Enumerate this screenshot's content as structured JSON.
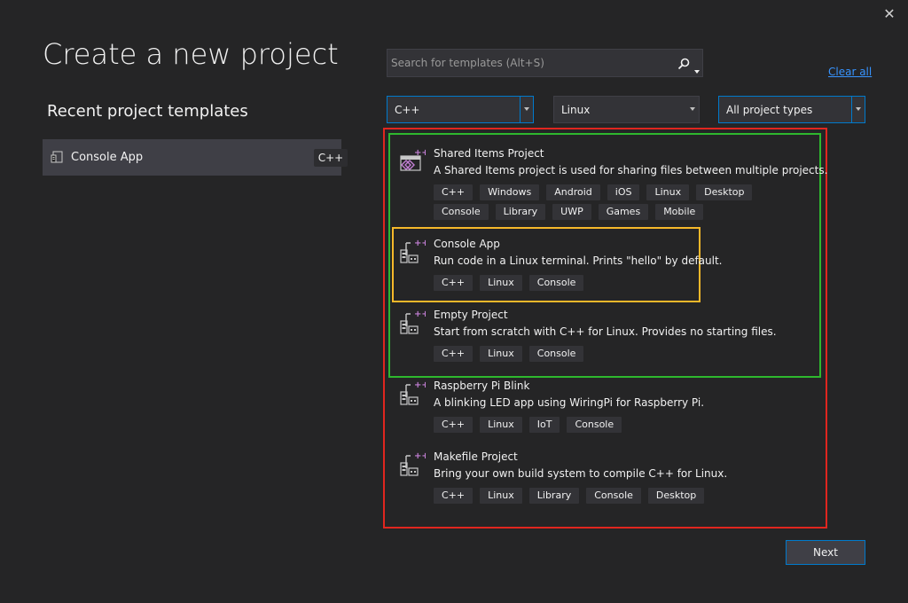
{
  "title": "Create a new project",
  "recent": {
    "heading": "Recent project templates",
    "items": [
      {
        "name": "Console App",
        "lang": "C++"
      }
    ]
  },
  "search": {
    "placeholder": "Search for templates (Alt+S)"
  },
  "clear_all": "Clear all",
  "filters": {
    "language": "C++",
    "platform": "Linux",
    "project_type": "All project types"
  },
  "templates": [
    {
      "name": "Shared Items Project",
      "desc": "A Shared Items project is used for sharing files between multiple projects.",
      "icon": "shared-items-icon",
      "tags": [
        "C++",
        "Windows",
        "Android",
        "iOS",
        "Linux",
        "Desktop",
        "Console",
        "Library",
        "UWP",
        "Games",
        "Mobile"
      ]
    },
    {
      "name": "Console App",
      "desc": "Run code in a Linux terminal. Prints \"hello\" by default.",
      "icon": "linux-project-icon",
      "tags": [
        "C++",
        "Linux",
        "Console"
      ]
    },
    {
      "name": "Empty Project",
      "desc": "Start from scratch with C++ for Linux. Provides no starting files.",
      "icon": "linux-project-icon",
      "tags": [
        "C++",
        "Linux",
        "Console"
      ]
    },
    {
      "name": "Raspberry Pi Blink",
      "desc": "A blinking LED app using WiringPi for Raspberry Pi.",
      "icon": "linux-project-icon",
      "tags": [
        "C++",
        "Linux",
        "IoT",
        "Console"
      ]
    },
    {
      "name": "Makefile Project",
      "desc": "Bring your own build system to compile C++ for Linux.",
      "icon": "linux-project-icon",
      "tags": [
        "C++",
        "Linux",
        "Library",
        "Console",
        "Desktop"
      ]
    }
  ],
  "next_label": "Next",
  "colors": {
    "background": "#252526",
    "accent": "#007acc",
    "link": "#3794ff",
    "highlight_red": "#e0261f",
    "highlight_green": "#2eb82e",
    "highlight_yellow": "#f5b82a"
  }
}
